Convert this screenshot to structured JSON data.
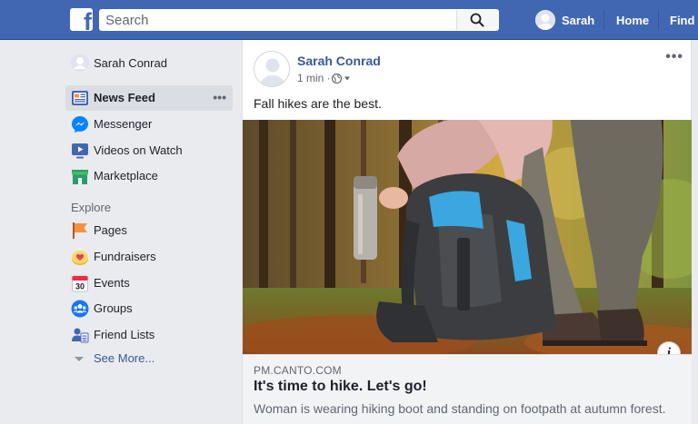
{
  "topbar": {
    "logo": "f",
    "search_placeholder": "Search",
    "profile_name": "Sarah",
    "home_label": "Home",
    "find_label": "Find F"
  },
  "sidebar": {
    "profile_name": "Sarah Conrad",
    "items": [
      {
        "label": "News Feed",
        "icon": "news-feed-icon",
        "active": true,
        "more": "•••"
      },
      {
        "label": "Messenger",
        "icon": "messenger-icon"
      },
      {
        "label": "Videos on Watch",
        "icon": "watch-icon"
      },
      {
        "label": "Marketplace",
        "icon": "marketplace-icon"
      }
    ],
    "explore_heading": "Explore",
    "explore_items": [
      {
        "label": "Pages",
        "icon": "pages-flag-icon"
      },
      {
        "label": "Fundraisers",
        "icon": "fundraisers-icon"
      },
      {
        "label": "Events",
        "icon": "events-calendar-icon",
        "day": "30"
      },
      {
        "label": "Groups",
        "icon": "groups-icon"
      },
      {
        "label": "Friend Lists",
        "icon": "friend-lists-icon"
      }
    ],
    "see_more": "See More..."
  },
  "post": {
    "author": "Sarah Conrad",
    "time": "1 min ·",
    "menu": "•••",
    "text": "Fall hikes are the best.",
    "info_label": "i",
    "link": {
      "domain": "PM.CANTO.COM",
      "title": "It's time to hike. Let's go!",
      "description": "Woman is wearing hiking boot and standing on footpath at autumn forest."
    }
  },
  "colors": {
    "brand_blue": "#4267b2",
    "link_blue": "#365899",
    "page_bg": "#e9ebee"
  }
}
